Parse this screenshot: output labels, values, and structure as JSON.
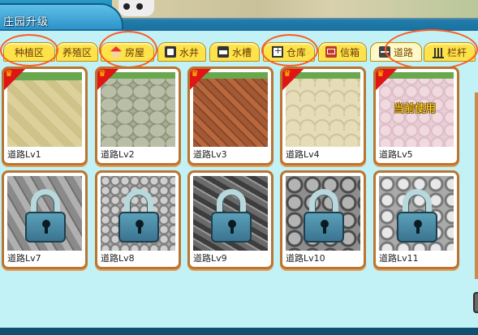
{
  "header": {
    "title": "庄园升级"
  },
  "tabs": [
    {
      "label": "种植区",
      "icon": "",
      "active": false,
      "circled": true
    },
    {
      "label": "养殖区",
      "icon": "",
      "active": false,
      "circled": false
    },
    {
      "label": "房屋",
      "icon": "house-icon",
      "active": false,
      "circled": true
    },
    {
      "label": "水井",
      "icon": "well-icon",
      "active": false,
      "circled": false
    },
    {
      "label": "水槽",
      "icon": "trough-icon",
      "active": false,
      "circled": false
    },
    {
      "label": "仓库",
      "icon": "warehouse-icon",
      "active": false,
      "circled": true
    },
    {
      "label": "信箱",
      "icon": "mailbox-icon",
      "active": false,
      "circled": false
    },
    {
      "label": "道路",
      "icon": "road-icon",
      "active": true,
      "circled": true
    },
    {
      "label": "栏杆",
      "icon": "fence-icon",
      "active": false,
      "circled": true
    }
  ],
  "items_row1": [
    {
      "label": "道路Lv1",
      "crown": true,
      "locked": false,
      "status": ""
    },
    {
      "label": "道路Lv2",
      "crown": true,
      "locked": false,
      "status": ""
    },
    {
      "label": "道路Lv3",
      "crown": true,
      "locked": false,
      "status": ""
    },
    {
      "label": "道路Lv4",
      "crown": true,
      "locked": false,
      "status": ""
    },
    {
      "label": "道路Lv5",
      "crown": true,
      "locked": false,
      "status": "当前使用"
    }
  ],
  "items_row2": [
    {
      "label": "道路Lv7",
      "locked": true
    },
    {
      "label": "道路Lv8",
      "locked": true
    },
    {
      "label": "道路Lv9",
      "locked": true
    },
    {
      "label": "道路Lv10",
      "locked": true
    },
    {
      "label": "道路Lv11",
      "locked": true
    }
  ],
  "colors": {
    "highlight_ring": "#ff5a1f",
    "tab_yellow": "#fde24a",
    "panel_bg": "#c2f2f6",
    "card_border": "#b97531"
  }
}
